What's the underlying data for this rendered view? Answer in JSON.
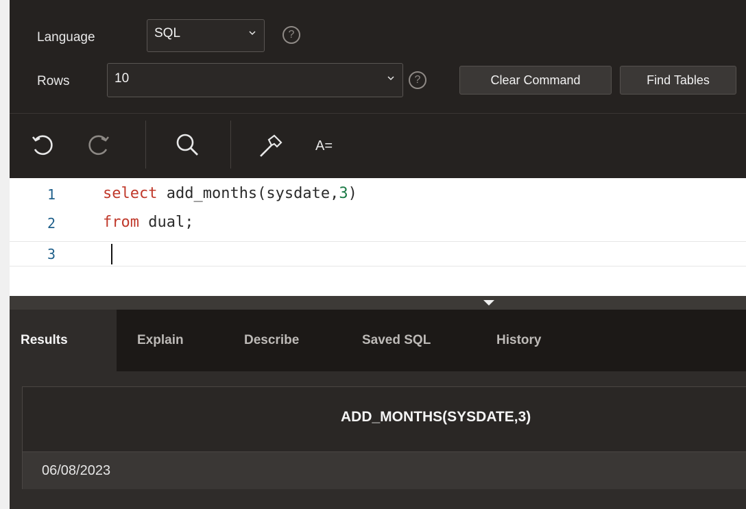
{
  "controls": {
    "language_label": "Language",
    "language_value": "SQL",
    "rows_label": "Rows",
    "rows_value": "10",
    "help_glyph": "?",
    "clear_button": "Clear Command",
    "find_button": "Find Tables"
  },
  "toolbar": {
    "icons": [
      "undo-icon",
      "redo-icon",
      "search-icon",
      "hammer-icon",
      "format-icon"
    ],
    "format_label": "A="
  },
  "editor": {
    "lines": [
      {
        "num": "1",
        "kw": "select",
        "rest": " add_months(sysdate,",
        "num_lit": "3",
        "tail": ")"
      },
      {
        "num": "2",
        "kw": "from",
        "rest": " dual;"
      },
      {
        "num": "3"
      }
    ]
  },
  "tabs": [
    "Results",
    "Explain",
    "Describe",
    "Saved SQL",
    "History"
  ],
  "results": {
    "columns": [
      "ADD_MONTHS(SYSDATE,3)"
    ],
    "rows": [
      [
        "06/08/2023"
      ]
    ]
  },
  "colors": {
    "background": "#1e1b19",
    "keyword": "#c0392b",
    "number": "#1a7a45",
    "line_number": "#1e5f8a"
  }
}
